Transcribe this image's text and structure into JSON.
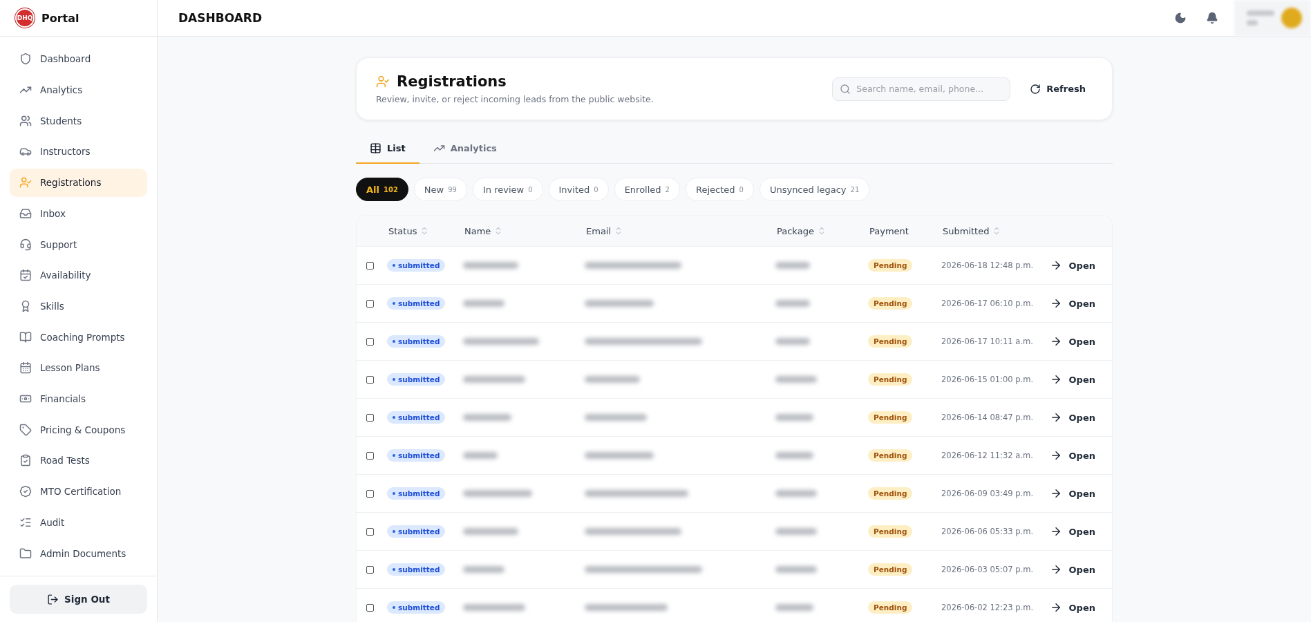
{
  "brand": {
    "logo": "DHQ",
    "name": "Portal"
  },
  "header": {
    "title": "DASHBOARD"
  },
  "sidebar": {
    "items": [
      {
        "label": "Dashboard",
        "selected": false
      },
      {
        "label": "Analytics",
        "selected": false
      },
      {
        "label": "Students",
        "selected": false
      },
      {
        "label": "Instructors",
        "selected": false
      },
      {
        "label": "Registrations",
        "selected": true
      },
      {
        "label": "Inbox",
        "selected": false
      },
      {
        "label": "Support",
        "selected": false
      },
      {
        "label": "Availability",
        "selected": false
      },
      {
        "label": "Skills",
        "selected": false
      },
      {
        "label": "Coaching Prompts",
        "selected": false
      },
      {
        "label": "Lesson Plans",
        "selected": false
      },
      {
        "label": "Financials",
        "selected": false
      },
      {
        "label": "Pricing & Coupons",
        "selected": false
      },
      {
        "label": "Road Tests",
        "selected": false
      },
      {
        "label": "MTO Certification",
        "selected": false
      },
      {
        "label": "Audit",
        "selected": false
      },
      {
        "label": "Admin Documents",
        "selected": false
      }
    ],
    "sign_out": "Sign Out"
  },
  "page": {
    "title": "Registrations",
    "subtitle": "Review, invite, or reject incoming leads from the public website.",
    "search": {
      "placeholder": "Search name, email, phone..."
    },
    "refresh": "Refresh"
  },
  "tabs": [
    {
      "label": "List",
      "selected": true
    },
    {
      "label": "Analytics",
      "selected": false
    }
  ],
  "filters": [
    {
      "label": "All",
      "count": "102",
      "selected": true
    },
    {
      "label": "New",
      "count": "99",
      "selected": false
    },
    {
      "label": "In review",
      "count": "0",
      "selected": false
    },
    {
      "label": "Invited",
      "count": "0",
      "selected": false
    },
    {
      "label": "Enrolled",
      "count": "2",
      "selected": false
    },
    {
      "label": "Rejected",
      "count": "0",
      "selected": false
    },
    {
      "label": "Unsynced legacy",
      "count": "21",
      "selected": false
    }
  ],
  "table": {
    "columns": [
      {
        "label": "Status",
        "sortable": true
      },
      {
        "label": "Name",
        "sortable": true
      },
      {
        "label": "Email",
        "sortable": true
      },
      {
        "label": "Package",
        "sortable": true
      },
      {
        "label": "Payment",
        "sortable": false
      },
      {
        "label": "Submitted",
        "sortable": true
      }
    ],
    "rows": [
      {
        "checked": false,
        "status": "submitted",
        "payment": "Pending",
        "submitted": "2026-06-18 12:48 p.m.",
        "action": "Open"
      },
      {
        "checked": false,
        "status": "submitted",
        "payment": "Pending",
        "submitted": "2026-06-17 06:10 p.m.",
        "action": "Open"
      },
      {
        "checked": false,
        "status": "submitted",
        "payment": "Pending",
        "submitted": "2026-06-17 10:11 a.m.",
        "action": "Open"
      },
      {
        "checked": false,
        "status": "submitted",
        "payment": "Pending",
        "submitted": "2026-06-15 01:00 p.m.",
        "action": "Open"
      },
      {
        "checked": false,
        "status": "submitted",
        "payment": "Pending",
        "submitted": "2026-06-14 08:47 p.m.",
        "action": "Open"
      },
      {
        "checked": false,
        "status": "submitted",
        "payment": "Pending",
        "submitted": "2026-06-12 11:32 a.m.",
        "action": "Open"
      },
      {
        "checked": false,
        "status": "submitted",
        "payment": "Pending",
        "submitted": "2026-06-09 03:49 p.m.",
        "action": "Open"
      },
      {
        "checked": false,
        "status": "submitted",
        "payment": "Pending",
        "submitted": "2026-06-06 05:33 p.m.",
        "action": "Open"
      },
      {
        "checked": false,
        "status": "submitted",
        "payment": "Pending",
        "submitted": "2026-06-03 05:07 p.m.",
        "action": "Open"
      },
      {
        "checked": false,
        "status": "submitted",
        "payment": "Pending",
        "submitted": "2026-06-02 12:23 p.m.",
        "action": "Open"
      }
    ]
  }
}
